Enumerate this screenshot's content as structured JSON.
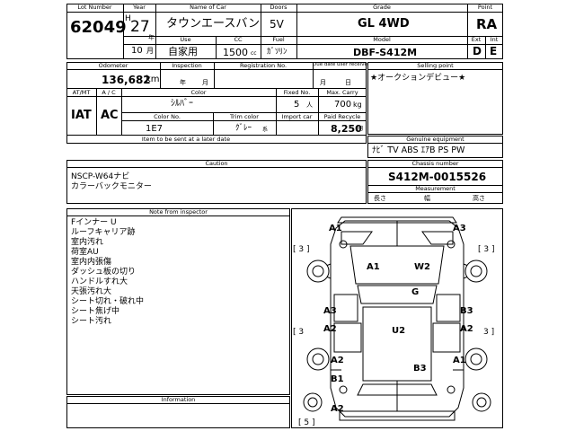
{
  "header": {
    "lot_number_label": "Lot Number",
    "lot_number": "62049",
    "year_label": "Year",
    "year_era": "H",
    "year": "27",
    "year_suffix": "年",
    "month": "10",
    "month_suffix": "月",
    "name_label": "Name of Car",
    "name": "タウンエースバン",
    "doors_label": "Doors",
    "doors": "5V",
    "grade_label": "Grade",
    "grade": "GL 4WD",
    "point_label": "Point",
    "point": "RA",
    "use_label": "Use",
    "use": "自家用",
    "cc_label": "CC",
    "cc": "1500",
    "cc_unit": "cc",
    "fuel_label": "Fuel",
    "fuel": "ｶﾞｿﾘﾝ",
    "model_label": "Model",
    "model": "DBF-S412M",
    "ext_label": "Ext",
    "ext": "D",
    "int_label": "Int",
    "int": "E"
  },
  "odometer": {
    "label": "Odometer",
    "value": "136,682",
    "unit": "km"
  },
  "inspection": {
    "label": "Inspection",
    "year_suffix": "年",
    "month_suffix": "月"
  },
  "registration": {
    "label": "Registration No."
  },
  "due_date": {
    "label": "Due date user receive",
    "month_suffix": "月",
    "day_suffix": "日"
  },
  "selling_point": {
    "label": "Selling point",
    "text": "★オークションデビュー★"
  },
  "transmission": {
    "label": "AT/MT",
    "value": "IAT"
  },
  "ac": {
    "label": "A / C",
    "value": "AC"
  },
  "color": {
    "label": "Color",
    "value": "ｼﾙﾊﾞｰ"
  },
  "fixed_no": {
    "label": "Fixed No.",
    "value": "5",
    "unit": "人"
  },
  "max_carry": {
    "label": "Max. Carry",
    "value": "700",
    "unit": "kg"
  },
  "color_no": {
    "label": "Color No.",
    "value": "1E7"
  },
  "trim_color": {
    "label": "Trim color",
    "value": "ｸﾞﾚｰ",
    "suffix": "系"
  },
  "import_car": {
    "label": "Import car"
  },
  "recycle": {
    "label": "Paid Recycle",
    "value": "8,250",
    "unit": "円"
  },
  "later_items": {
    "label": "Item to be sent at a later date"
  },
  "equipment": {
    "label": "Genuine equipment",
    "value": "ﾅﾋﾞ TV ABS ｴｱB PS PW"
  },
  "caution": {
    "label": "Caution",
    "lines": [
      "NSCP-W64ナビ",
      "カラーバックモニター"
    ]
  },
  "chassis": {
    "label": "Chassis number",
    "value": "S412M-0015526"
  },
  "measurement": {
    "label": "Measurement",
    "length": "長さ",
    "width": "幅",
    "height": "高さ"
  },
  "notes": {
    "label": "Note from inspector",
    "lines": [
      "Fインナー U",
      "ルーフキャリア跡",
      "室内汚れ",
      "荷室AU",
      "室内内張傷",
      "ダッシュ板の切り",
      "ハンドルすれ大",
      "天張汚れ大",
      "シート切れ・破れ中",
      "シート焦げ中",
      "シート汚れ"
    ]
  },
  "information": {
    "label": "Information"
  },
  "diagram": {
    "marks": {
      "front_left": "A1",
      "front_right": "A3",
      "hood_left": "A1",
      "windshield": "W2",
      "glass": "G",
      "left_door1": "A3",
      "right_door1": "B3",
      "left_door2": "A2",
      "right_door2": "A2",
      "roof": "U2",
      "rear_left": "A2",
      "rear_right": "A1",
      "rear_panel": "B3",
      "rear_corner": "B1",
      "rear_bottom": "A2"
    },
    "bracket_left_front": "[ 3 ]",
    "bracket_right_front": "[ 3 ]",
    "bracket_left_mid": "[ 3",
    "bracket_right_mid": "3 ]",
    "bracket_bottom": "[ 5 ]"
  }
}
